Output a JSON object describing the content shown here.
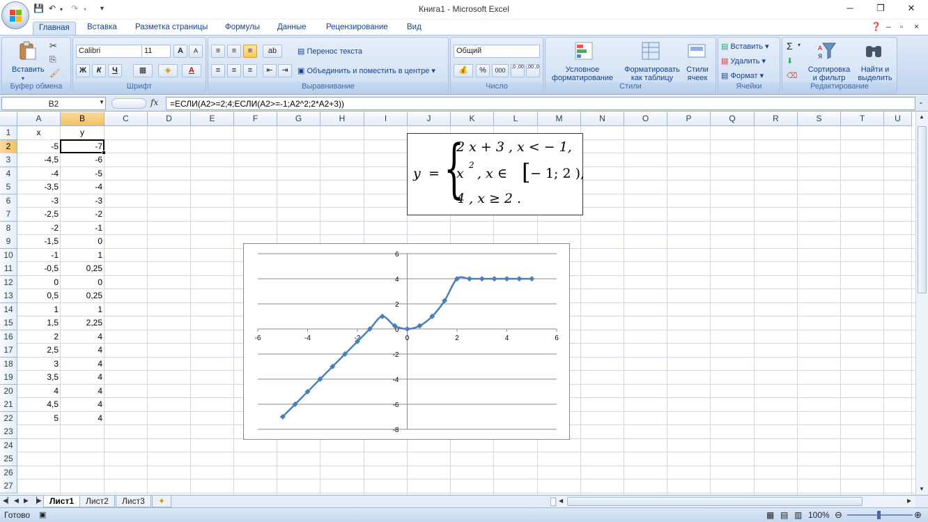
{
  "window": {
    "title": "Книга1 - Microsoft Excel",
    "minimize": "─",
    "restore": "❐",
    "close": "✕"
  },
  "ribbon_tabs": [
    "Главная",
    "Вставка",
    "Разметка страницы",
    "Формулы",
    "Данные",
    "Рецензирование",
    "Вид"
  ],
  "ribbon": {
    "clipboard": {
      "paste": "Вставить",
      "label": "Буфер обмена"
    },
    "font": {
      "name": "Calibri",
      "size": "11",
      "bold": "Ж",
      "italic": "К",
      "underline": "Ч",
      "font_color_glyph": "A",
      "grow": "A",
      "shrink": "A",
      "label": "Шрифт"
    },
    "alignment": {
      "wrap": "Перенос текста",
      "merge": "Объединить и поместить в центре",
      "label": "Выравнивание"
    },
    "number": {
      "format": "Общий",
      "percent": "%",
      "thousands": "000",
      "inc_dec": ",0 ,00",
      "dec_dec": ",00 ,0",
      "label": "Число"
    },
    "styles": {
      "conditional": "Условное форматирование",
      "as_table": "Форматировать как таблицу",
      "cell_styles": "Стили ячеек",
      "label": "Стили"
    },
    "cells": {
      "insert": "Вставить",
      "delete": "Удалить",
      "format": "Формат",
      "label": "Ячейки"
    },
    "editing": {
      "sigma": "Σ",
      "sort": "Сортировка и фильтр",
      "find": "Найти и выделить",
      "label": "Редактирование"
    }
  },
  "formula_bar": {
    "name_box": "B2",
    "fx": "fx",
    "formula": "=ЕСЛИ(A2>=2;4;ЕСЛИ(A2>=-1;A2^2;2*A2+3))"
  },
  "columns": [
    "A",
    "B",
    "C",
    "D",
    "E",
    "F",
    "G",
    "H",
    "I",
    "J",
    "K",
    "L",
    "M",
    "N",
    "O",
    "P",
    "Q",
    "R",
    "S",
    "T",
    "U"
  ],
  "rows": [
    "1",
    "2",
    "3",
    "4",
    "5",
    "6",
    "7",
    "8",
    "9",
    "10",
    "11",
    "12",
    "13",
    "14",
    "15",
    "16",
    "17",
    "18",
    "19",
    "20",
    "21",
    "22",
    "23",
    "24",
    "25",
    "26",
    "27"
  ],
  "header_cells": {
    "a1": "x",
    "b1": "y"
  },
  "table": {
    "x": [
      "-5",
      "-4,5",
      "-4",
      "-3,5",
      "-3",
      "-2,5",
      "-2",
      "-1,5",
      "-1",
      "-0,5",
      "0",
      "0,5",
      "1",
      "1,5",
      "2",
      "2,5",
      "3",
      "3,5",
      "4",
      "4,5",
      "5"
    ],
    "y": [
      "-7",
      "-6",
      "-5",
      "-4",
      "-3",
      "-2",
      "-1",
      "0",
      "1",
      "0,25",
      "0",
      "0,25",
      "1",
      "2,25",
      "4",
      "4",
      "4",
      "4",
      "4",
      "4",
      "4"
    ]
  },
  "equation": {
    "lhs": "y",
    "eq": "=",
    "brace": "{",
    "line1": "2 x + 3 ,  x < − 1,",
    "line2a": "x",
    "line2sup": "2",
    "line2b": ",  x ∈",
    "line2bracket": "[",
    "line2c": "− 1; 2 ),",
    "line3": "4 ,  x ≥ 2 ."
  },
  "chart_data": {
    "type": "scatter",
    "title": "",
    "xlabel": "",
    "ylabel": "",
    "xlim": [
      -6,
      6
    ],
    "ylim": [
      -8,
      6
    ],
    "x_ticks": [
      "-6",
      "-4",
      "-2",
      "0",
      "2",
      "4",
      "6"
    ],
    "y_ticks": [
      "-8",
      "-6",
      "-4",
      "-2",
      "0",
      "2",
      "4",
      "6"
    ],
    "grid": "horizontal major gridlines",
    "legend": "none",
    "smoothed": true,
    "marker": "diamond",
    "color": "#4a7ebb",
    "series": [
      {
        "x": [
          -5,
          -4.5,
          -4,
          -3.5,
          -3,
          -2.5,
          -2,
          -1.5,
          -1,
          -0.5,
          0,
          0.5,
          1,
          1.5,
          2,
          2.5,
          3,
          3.5,
          4,
          4.5,
          5
        ],
        "y": [
          -7,
          -6,
          -5,
          -4,
          -3,
          -2,
          -1,
          0,
          1,
          0.25,
          0,
          0.25,
          1,
          2.25,
          4,
          4,
          4,
          4,
          4,
          4,
          4
        ]
      }
    ]
  },
  "sheets": [
    "Лист1",
    "Лист2",
    "Лист3"
  ],
  "status": {
    "ready": "Готово",
    "zoom": "100%"
  }
}
